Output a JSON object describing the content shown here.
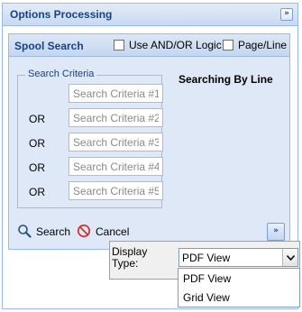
{
  "outer": {
    "title": "Options Processing",
    "collapse_icon": "»"
  },
  "spool": {
    "title": "Spool Search",
    "and_or_label": "Use AND/OR Logic",
    "page_line_label": "Page/Line",
    "searching_by": "Searching By Line"
  },
  "criteria": {
    "legend": "Search Criteria",
    "fields": [
      {
        "placeholder": "Search Criteria #1",
        "operator": ""
      },
      {
        "placeholder": "Search Criteria #2",
        "operator": "OR"
      },
      {
        "placeholder": "Search Criteria #3",
        "operator": "OR"
      },
      {
        "placeholder": "Search Criteria #4",
        "operator": "OR"
      },
      {
        "placeholder": "Search Criteria #5",
        "operator": "OR"
      }
    ]
  },
  "buttons": {
    "search": "Search",
    "cancel": "Cancel",
    "expand_icon": "»"
  },
  "display": {
    "label_line1": "Display",
    "label_line2": "Type:",
    "selected": "PDF View",
    "options": [
      "PDF View",
      "Grid View"
    ]
  },
  "colors": {
    "header_text": "#15428b",
    "panel_border": "#99bbe8",
    "panel_bg": "#dfe8f6"
  }
}
